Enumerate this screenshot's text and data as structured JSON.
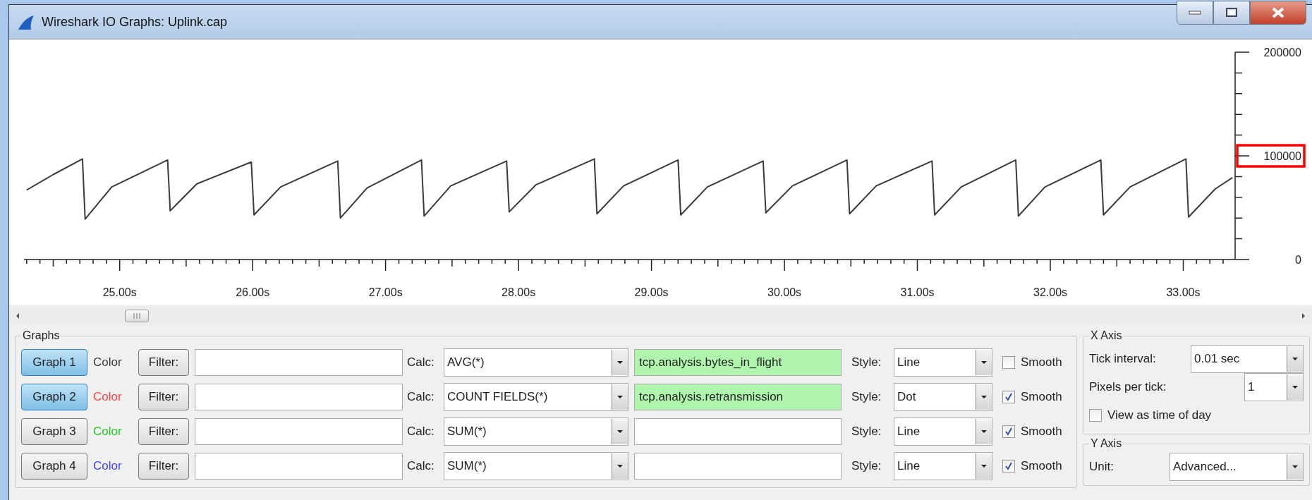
{
  "window": {
    "title": "Wireshark IO Graphs: Uplink.cap"
  },
  "chart": {
    "chart_data": {
      "type": "line",
      "xlim": [
        24.28,
        33.39
      ],
      "ylim": [
        0,
        200000
      ],
      "xticks": [
        {
          "value": 25,
          "label": "25.00s"
        },
        {
          "value": 26,
          "label": "26.00s"
        },
        {
          "value": 27,
          "label": "27.00s"
        },
        {
          "value": 28,
          "label": "28.00s"
        },
        {
          "value": 29,
          "label": "29.00s"
        },
        {
          "value": 30,
          "label": "30.00s"
        },
        {
          "value": 31,
          "label": "31.00s"
        },
        {
          "value": 32,
          "label": "32.00s"
        },
        {
          "value": 33,
          "label": "33.00s"
        }
      ],
      "yticks": [
        0,
        100000,
        200000
      ],
      "x": [
        24.3,
        24.5,
        24.72,
        24.74,
        24.94,
        25.36,
        25.38,
        25.58,
        25.99,
        26.01,
        26.21,
        26.64,
        26.66,
        26.86,
        27.27,
        27.29,
        27.49,
        27.91,
        27.93,
        28.13,
        28.57,
        28.59,
        28.79,
        29.2,
        29.22,
        29.42,
        29.84,
        29.86,
        30.06,
        30.47,
        30.49,
        30.69,
        31.11,
        31.13,
        31.33,
        31.74,
        31.76,
        31.96,
        32.38,
        32.4,
        32.6,
        33.02,
        33.04,
        33.24,
        33.37
      ],
      "values": [
        67000,
        82000,
        97000,
        39000,
        70000,
        96000,
        47000,
        73000,
        94000,
        43000,
        70000,
        95000,
        40000,
        69000,
        96000,
        42000,
        71000,
        95000,
        46000,
        72000,
        97000,
        44000,
        71000,
        96000,
        43000,
        70000,
        95000,
        45000,
        71000,
        96000,
        44000,
        71000,
        95000,
        43000,
        70000,
        96000,
        42000,
        70000,
        96000,
        43000,
        70000,
        97000,
        41000,
        68000,
        79000
      ]
    },
    "highlight_box": {
      "shown": true,
      "color": "#ff0000"
    }
  },
  "graphs_panel": {
    "title": "Graphs",
    "rows": [
      {
        "button": "Graph 1",
        "selected": true,
        "color_label": "Color",
        "color": "#3a3a3a",
        "filter_button": "Filter:",
        "calc_label": "Calc:",
        "calc": "AVG(*)",
        "field": "tcp.analysis.bytes_in_flight",
        "field_highlighted": true,
        "style_label": "Style:",
        "style": "Line",
        "smooth": false,
        "smooth_label": "Smooth"
      },
      {
        "button": "Graph 2",
        "selected": true,
        "color_label": "Color",
        "color": "#ff4040",
        "filter_button": "Filter:",
        "calc_label": "Calc:",
        "calc": "COUNT FIELDS(*)",
        "field": "tcp.analysis.retransmission",
        "field_highlighted": true,
        "style_label": "Style:",
        "style": "Dot",
        "smooth": true,
        "smooth_label": "Smooth"
      },
      {
        "button": "Graph 3",
        "selected": false,
        "color_label": "Color",
        "color": "#22cc22",
        "filter_button": "Filter:",
        "calc_label": "Calc:",
        "calc": "SUM(*)",
        "field_highlighted": false,
        "style_label": "Style:",
        "style": "Line",
        "smooth": true,
        "smooth_label": "Smooth"
      },
      {
        "button": "Graph 4",
        "selected": false,
        "color_label": "Color",
        "color": "#4040ff",
        "filter_button": "Filter:",
        "calc_label": "Calc:",
        "calc": "SUM(*)",
        "field_highlighted": false,
        "style_label": "Style:",
        "style": "Line",
        "smooth": true,
        "smooth_label": "Smooth"
      }
    ]
  },
  "x_axis_panel": {
    "title": "X Axis",
    "tick_interval_label": "Tick interval:",
    "tick_interval": "0.01 sec",
    "pixels_per_tick_label": "Pixels per tick:",
    "pixels_per_tick": "1",
    "time_of_day_label": "View as time of day",
    "time_of_day": false
  },
  "y_axis_panel": {
    "title": "Y Axis",
    "unit_label": "Unit:",
    "unit": "Advanced..."
  }
}
